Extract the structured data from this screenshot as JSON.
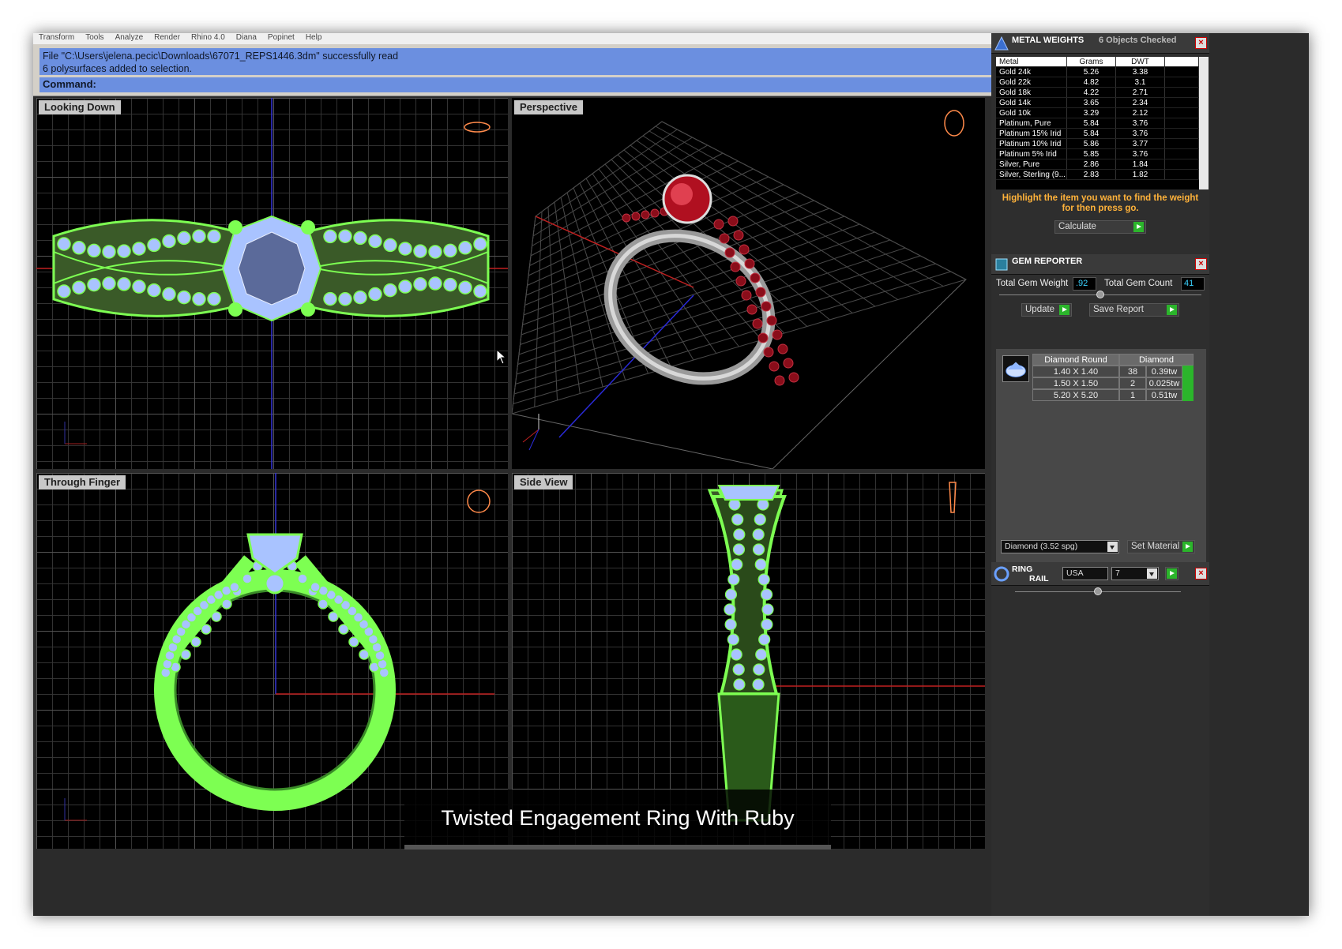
{
  "menubar": {
    "items": [
      "Transform",
      "Tools",
      "Analyze",
      "Render",
      "Rhino 4.0",
      "Diana",
      "Popinet",
      "Help"
    ]
  },
  "command": {
    "history_line1": "File \"C:\\Users\\jelena.pecic\\Downloads\\67071_REPS1446.3dm\" successfully read",
    "history_line2": "6 polysurfaces added to selection.",
    "prompt_label": "Command:"
  },
  "viewports": {
    "top": {
      "label": "Looking Down"
    },
    "perspective": {
      "label": "Perspective"
    },
    "front": {
      "label": "Through Finger"
    },
    "right": {
      "label": "Side View"
    }
  },
  "caption": "Twisted Engagement Ring With Ruby",
  "metal_weights": {
    "title": "METAL WEIGHTS",
    "objects_checked": "6 Objects Checked",
    "columns": [
      "Metal",
      "Grams",
      "DWT"
    ],
    "rows": [
      {
        "metal": "Gold 24k",
        "grams": "5.26",
        "dwt": "3.38"
      },
      {
        "metal": "Gold 22k",
        "grams": "4.82",
        "dwt": "3.1"
      },
      {
        "metal": "Gold 18k",
        "grams": "4.22",
        "dwt": "2.71"
      },
      {
        "metal": "Gold 14k",
        "grams": "3.65",
        "dwt": "2.34"
      },
      {
        "metal": "Gold 10k",
        "grams": "3.29",
        "dwt": "2.12"
      },
      {
        "metal": "Platinum, Pure",
        "grams": "5.84",
        "dwt": "3.76"
      },
      {
        "metal": "Platinum 15% Irid",
        "grams": "5.84",
        "dwt": "3.76"
      },
      {
        "metal": "Platinum 10% Irid",
        "grams": "5.86",
        "dwt": "3.77"
      },
      {
        "metal": "Platinum 5% Irid",
        "grams": "5.85",
        "dwt": "3.76"
      },
      {
        "metal": "Silver, Pure",
        "grams": "2.86",
        "dwt": "1.84"
      },
      {
        "metal": "Silver, Sterling (9...",
        "grams": "2.83",
        "dwt": "1.82"
      }
    ],
    "hint": "Highlight the item you want to find the weight for then press go.",
    "calculate_label": "Calculate"
  },
  "gem_reporter": {
    "title": "GEM REPORTER",
    "total_weight_label": "Total Gem Weight",
    "total_weight_value": ".92",
    "total_count_label": "Total Gem Count",
    "total_count_value": "41",
    "update_label": "Update",
    "save_report_label": "Save Report",
    "table_header": [
      "Diamond Round",
      "Diamond"
    ],
    "rows": [
      {
        "size": "1.40 X 1.40",
        "count": "38",
        "weight": "0.39tw"
      },
      {
        "size": "1.50 X 1.50",
        "count": "2",
        "weight": "0.025tw"
      },
      {
        "size": "5.20 X 5.20",
        "count": "1",
        "weight": "0.51tw"
      }
    ],
    "material_value": "Diamond    (3.52 spg)",
    "set_material_label": "Set Material"
  },
  "ring_rail": {
    "title_line1": "RING",
    "title_line2": "RAIL",
    "country_value": "USA",
    "size_value": "7"
  },
  "colors": {
    "wire_green": "#7dff52",
    "stone_blue": "#a9c3ff",
    "ruby": "#b01020",
    "accent_orange": "#ffb23a",
    "cmd_blue": "#6b8fe0"
  },
  "icons": [
    "ring-thumbnail-icon",
    "close-icon",
    "go-arrow-icon",
    "dropdown-arrow-icon",
    "cursor-icon",
    "gem-icon"
  ]
}
